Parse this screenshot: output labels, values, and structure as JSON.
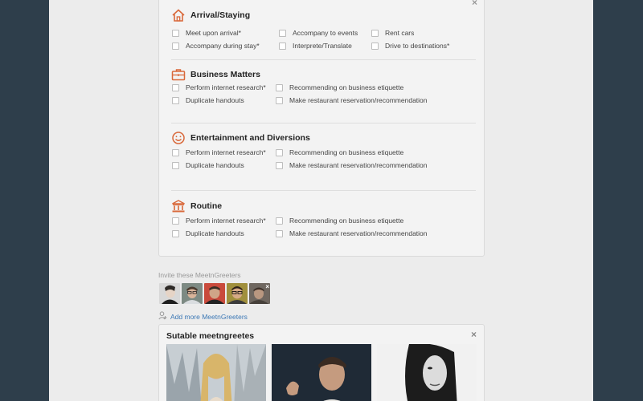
{
  "services": {
    "close_icon": "×",
    "sections": [
      {
        "title": "Arrival/Staying",
        "icon": "house-icon",
        "options": [
          "Meet upon arrival*",
          "Accompany to events",
          "Rent cars",
          "Accompany during stay*",
          "Interprete/Translate",
          "Drive to destinations*"
        ]
      },
      {
        "title": "Business Matters",
        "icon": "briefcase-icon",
        "options": [
          "Perform internet research*",
          "Recommending on business etiquette",
          "Duplicate handouts",
          "Make restaurant reservation/recommendation"
        ]
      },
      {
        "title": "Entertainment and Diversions",
        "icon": "smiley-icon",
        "options": [
          "Perform internet research*",
          "Recommending on business etiquette",
          "Duplicate handouts",
          "Make restaurant reservation/recommendation"
        ]
      },
      {
        "title": "Routine",
        "icon": "building-icon",
        "options": [
          "Perform internet research*",
          "Recommending on business etiquette",
          "Duplicate handouts",
          "Make restaurant reservation/recommendation"
        ]
      }
    ]
  },
  "invite": {
    "label": "Invite these MeetnGreeters",
    "remove_icon": "×",
    "add_more": "Add more MeetnGreeters"
  },
  "suitable": {
    "title": "Sutable meetngreetes",
    "close_icon": "×"
  },
  "colors": {
    "accent_icon": "#d9683a",
    "link": "#3c78b5",
    "background": "#2e3e4b"
  }
}
